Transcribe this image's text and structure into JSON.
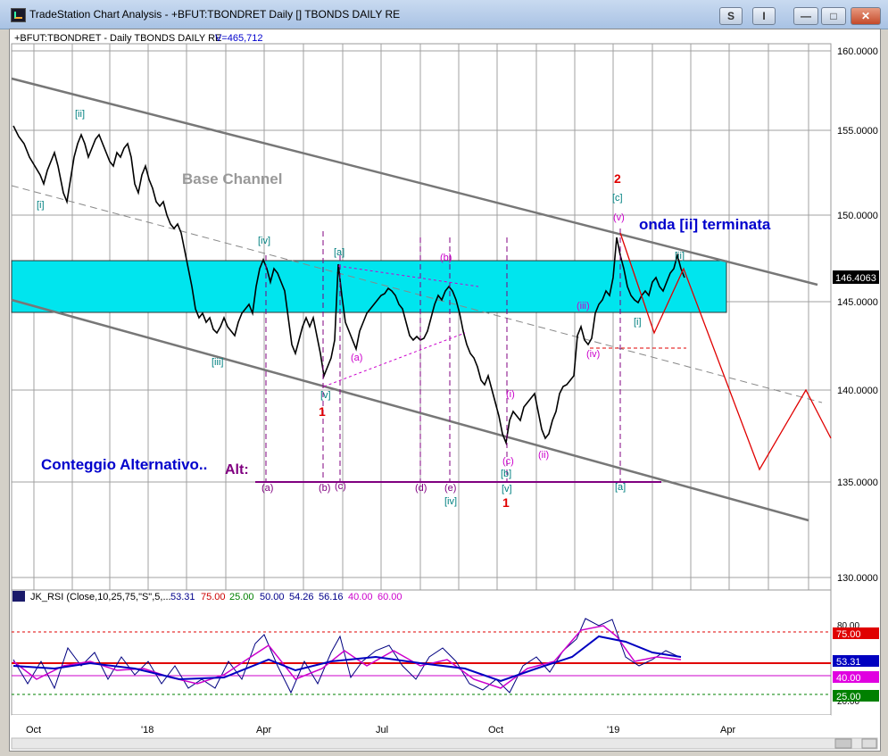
{
  "window": {
    "title": "TradeStation Chart Analysis - +BFUT:TBONDRET Daily [] TBONDS DAILY RE",
    "btn_s": "S",
    "btn_i": "I",
    "btn_min": "—",
    "btn_max": "□",
    "btn_close": "✕"
  },
  "chart": {
    "header": "+BFUT:TBONDRET - Daily  TBONDS DAILY RE",
    "volume": "V=465,712",
    "price_labels": [
      "160.0000",
      "155.0000",
      "150.0000",
      "145.0000",
      "140.0000",
      "135.0000",
      "130.0000"
    ],
    "last_price": "146.4063",
    "x_labels": [
      "Oct",
      "'18",
      "Apr",
      "Jul",
      "Oct",
      "'19",
      "Apr"
    ],
    "title_base_channel": "Base Channel",
    "title_onda": "onda [ii] terminata",
    "title_alt_count": "Conteggio Alternativo..",
    "title_alt": "Alt:",
    "wave_labels": {
      "i_big": "[i]",
      "ii_big": "[ii]",
      "iii_big": "[iii]",
      "iv_big": "[iv]",
      "v_big": "[v]",
      "a_big": "[a]",
      "b_big": "[b]",
      "c_big": "[c]",
      "v_big2": "[v]",
      "a_big2": "[a]",
      "iv_big2": "[iv]",
      "i_big2": "[i]",
      "ii_big2": "[ii]",
      "iii_small": "(iii)",
      "iv_small": "(iv)",
      "v_small": "(v)",
      "i_small": "(i)",
      "ii_small": "(ii)",
      "a_small": "(a)",
      "b_small": "(b)",
      "c_small": "(c)",
      "one_a": "1",
      "one_b": "1",
      "two": "2",
      "alt_a": "(a)",
      "alt_b": "(b)",
      "alt_c": "(c)",
      "alt_d": "(d)",
      "alt_e": "(e)"
    }
  },
  "rsi": {
    "name": "JK_RSI (Close,10,25,75,\"S\",5,...",
    "values": [
      "53.31",
      "75.00",
      "25.00",
      "50.00",
      "54.26",
      "56.16",
      "40.00",
      "60.00"
    ],
    "value_colors": [
      "#00008b",
      "#cc0000",
      "#008000",
      "#00008b",
      "#00008b",
      "#00008b",
      "#cc00cc",
      "#cc00cc"
    ],
    "axis_labels": [
      "80.00",
      "20.00"
    ],
    "badges": [
      "75.00",
      "53.31",
      "40.00",
      "25.00"
    ],
    "badge_colors": [
      "#e00000",
      "#0000c0",
      "#e000e0",
      "#008000"
    ]
  },
  "colors": {
    "channel_band": "#00e5ee",
    "wave_teal": "#008080",
    "wave_magenta": "#cc00cc",
    "wave_red": "#e00000",
    "text_blue": "#0000cc",
    "alt_purple": "#800080"
  }
}
